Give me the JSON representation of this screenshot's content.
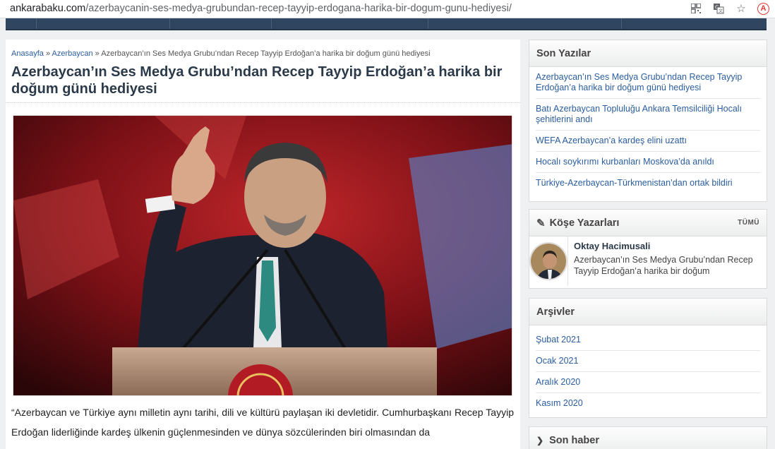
{
  "browser": {
    "url_host": "ankarabaku.com",
    "url_path": "/azerbaycanin-ses-medya-grubundan-recep-tayyip-erdogana-harika-bir-dogum-gunu-hediyesi/",
    "icons": [
      "qr-code-icon",
      "translate-icon",
      "star-icon",
      "extension-icon"
    ],
    "extension_label": "A"
  },
  "breadcrumb": {
    "home": "Anasayfa",
    "sep": "»",
    "category": "Azerbaycan",
    "current": "Azerbaycan’ın Ses Medya Grubu’ndan Recep Tayyip Erdoğan’a harika bir doğum günü hediyesi"
  },
  "article": {
    "title": "Azerbaycan’ın Ses Medya Grubu’ndan Recep Tayyip Erdoğan’a harika bir doğum günü hediyesi",
    "body": "“Azerbaycan ve Türkiye aynı milletin aynı tarihi, dili ve kültürü paylaşan iki devletidir. Cumhurbaşkanı Recep Tayyip Erdoğan liderliğinde kardeş ülkenin güçlenmesinden ve dünya sözcülerinden biri olmasından da"
  },
  "sidebar": {
    "recent": {
      "title": "Son Yazılar",
      "items": [
        "Azerbaycan’ın Ses Medya Grubu’ndan Recep Tayyip Erdoğan’a harika bir doğum günü hediyesi",
        "Batı Azerbaycan Topluluğu Ankara Temsilciliği Hocalı şehitlerini andı",
        "WEFA Azerbaycan’a kardeş elini uzattı",
        "Hocalı soykırımı kurbanları Moskova’da anıldı",
        "Türkiye-Azerbaycan-Türkmenistan’dan ortak bildiri"
      ]
    },
    "columnists": {
      "title": "Köşe Yazarları",
      "all_label": "TÜMÜ",
      "author_name": "Oktay Hacimusali",
      "author_excerpt": "Azerbaycan’ın Ses Medya Grubu’ndan Recep Tayyip Erdoğan’a harika bir doğum"
    },
    "archives": {
      "title": "Arşivler",
      "items": [
        "Şubat 2021",
        "Ocak 2021",
        "Aralık 2020",
        "Kasım 2020"
      ]
    },
    "latest": {
      "title": "Son haber"
    }
  }
}
